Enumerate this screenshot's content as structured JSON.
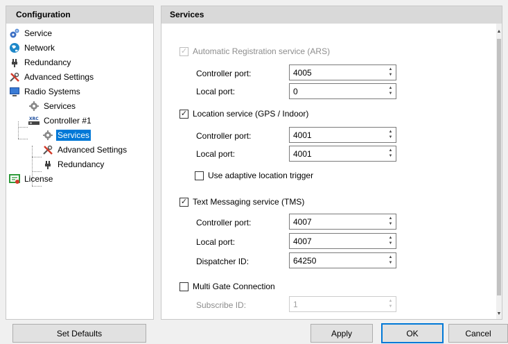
{
  "left_pane": {
    "header": "Configuration",
    "tree": [
      {
        "label": "Service",
        "icon": "gear-cog-icon"
      },
      {
        "label": "Network",
        "icon": "globe-icon"
      },
      {
        "label": "Redundancy",
        "icon": "plug-icon"
      },
      {
        "label": "Advanced Settings",
        "icon": "tools-icon"
      },
      {
        "label": "Radio Systems",
        "icon": "monitor-icon"
      },
      {
        "label": "Services",
        "icon": "gear-icon"
      },
      {
        "label": "Controller #1",
        "icon": "xrc-controller-icon",
        "icon_text": "XRC"
      },
      {
        "label": "Services",
        "icon": "gear-icon",
        "selected": true
      },
      {
        "label": "Advanced Settings",
        "icon": "tools-icon"
      },
      {
        "label": "Redundancy",
        "icon": "plug-icon"
      },
      {
        "label": "License",
        "icon": "license-icon"
      }
    ]
  },
  "right_pane": {
    "header": "Services",
    "ars": {
      "label": "Automatic Registration service (ARS)",
      "checked": true,
      "disabled": true,
      "controller_port_label": "Controller port:",
      "controller_port": "4005",
      "local_port_label": "Local port:",
      "local_port": "0"
    },
    "location": {
      "label": "Location service (GPS / Indoor)",
      "checked": true,
      "controller_port_label": "Controller port:",
      "controller_port": "4001",
      "local_port_label": "Local port:",
      "local_port": "4001",
      "adaptive_label": "Use adaptive location trigger",
      "adaptive_checked": false
    },
    "tms": {
      "label": "Text Messaging service (TMS)",
      "checked": true,
      "controller_port_label": "Controller port:",
      "controller_port": "4007",
      "local_port_label": "Local port:",
      "local_port": "4007",
      "dispatcher_label": "Dispatcher ID:",
      "dispatcher_id": "64250"
    },
    "multigate": {
      "label": "Multi Gate Connection",
      "checked": false,
      "subscribe_label": "Subscribe ID:",
      "subscribe_id": "1"
    }
  },
  "buttons": {
    "set_defaults": "Set Defaults",
    "apply": "Apply",
    "ok": "OK",
    "cancel": "Cancel"
  },
  "colors": {
    "selection": "#0078d7",
    "header_bg": "#d9d9d9",
    "default_button_border": "#0078d7"
  }
}
